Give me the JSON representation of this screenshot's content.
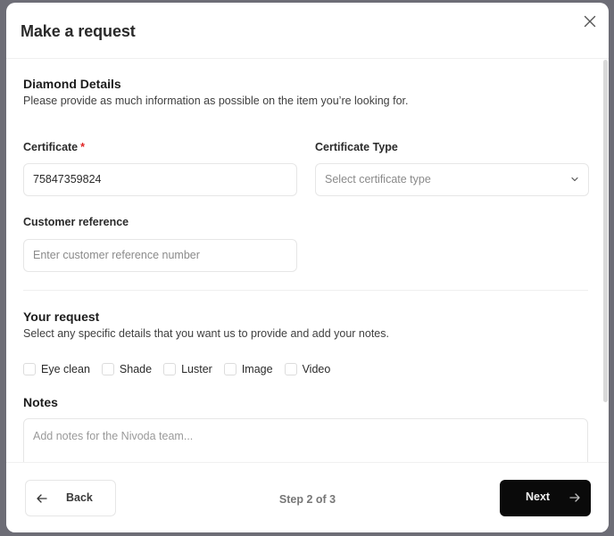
{
  "modal": {
    "title": "Make a request",
    "close_icon": "close-icon"
  },
  "diamond_details": {
    "title": "Diamond Details",
    "description": "Please provide as much information as possible on the item you’re looking for.",
    "certificate": {
      "label": "Certificate",
      "required_marker": "*",
      "value": "75847359824"
    },
    "certificate_type": {
      "label": "Certificate Type",
      "placeholder": "Select certificate type",
      "icon": "chevron-down-icon"
    },
    "customer_reference": {
      "label": "Customer reference",
      "placeholder": "Enter customer reference number",
      "value": ""
    }
  },
  "your_request": {
    "title": "Your request",
    "description": "Select any specific details that you want us to provide and add your notes.",
    "options": [
      {
        "label": "Eye clean",
        "checked": false
      },
      {
        "label": "Shade",
        "checked": false
      },
      {
        "label": "Luster",
        "checked": false
      },
      {
        "label": "Image",
        "checked": false
      },
      {
        "label": "Video",
        "checked": false
      }
    ]
  },
  "notes": {
    "title": "Notes",
    "placeholder": "Add notes for the Nivoda team...",
    "value": ""
  },
  "footer": {
    "back_label": "Back",
    "back_icon": "arrow-left-icon",
    "step_text": "Step 2 of 3",
    "next_label": "Next",
    "next_icon": "arrow-right-icon"
  },
  "colors": {
    "primary_button": "#0a0a0a",
    "required": "#e02424",
    "backdrop": "#6d6d76"
  }
}
